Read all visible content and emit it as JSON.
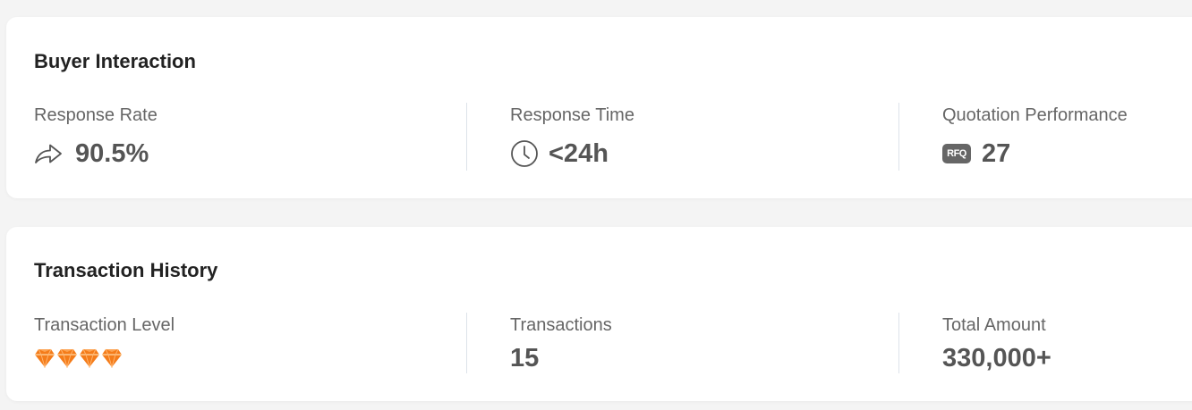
{
  "buyer_interaction": {
    "title": "Buyer Interaction",
    "response_rate": {
      "label": "Response Rate",
      "value": "90.5%",
      "icon": "share-arrow-icon"
    },
    "response_time": {
      "label": "Response Time",
      "value": "<24h",
      "icon": "clock-icon"
    },
    "quotation_performance": {
      "label": "Quotation Performance",
      "value": "27",
      "icon": "rfq-icon",
      "icon_text": "RFQ"
    }
  },
  "transaction_history": {
    "title": "Transaction History",
    "transaction_level": {
      "label": "Transaction Level",
      "diamonds": 4,
      "icon": "diamond-icon",
      "color": "#f47c1a"
    },
    "transactions": {
      "label": "Transactions",
      "value": "15"
    },
    "total_amount": {
      "label": "Total Amount",
      "value": "330,000+"
    }
  }
}
